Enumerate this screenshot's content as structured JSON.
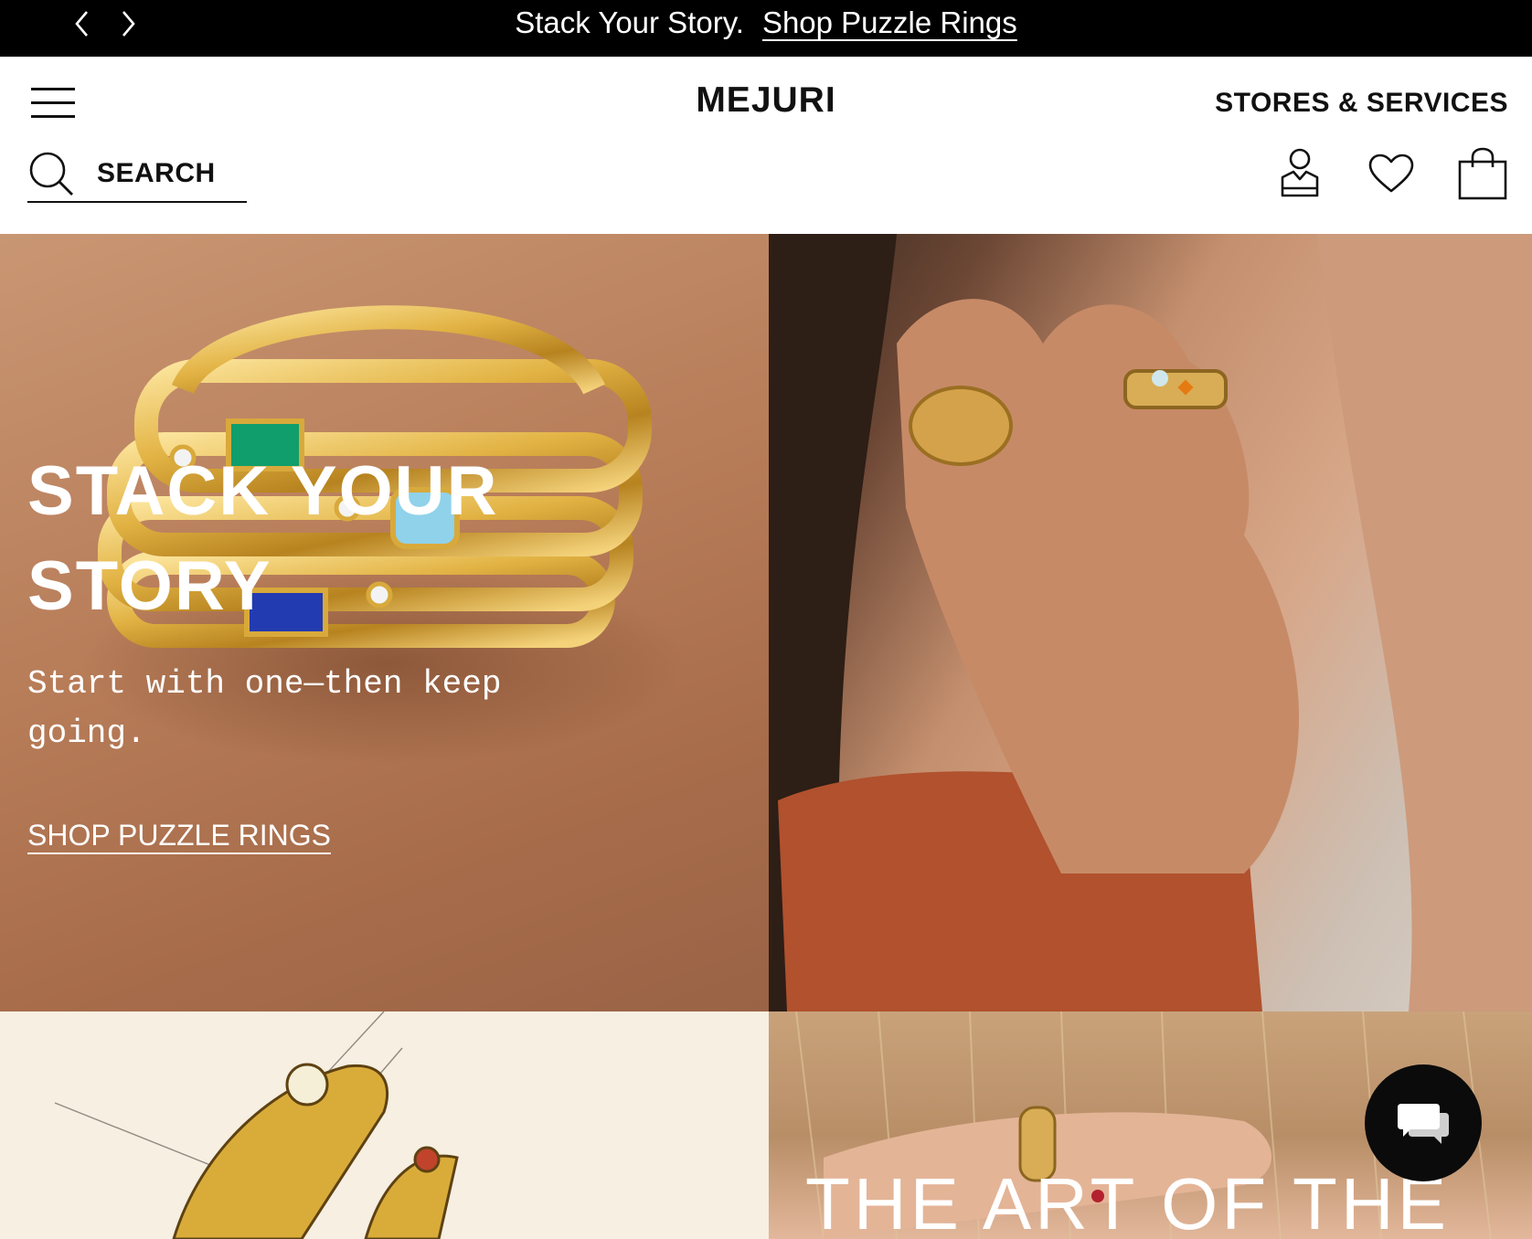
{
  "announcement": {
    "prev_label": "Previous announcement",
    "next_label": "Next announcement",
    "text": "Stack Your Story.",
    "link": "Shop Puzzle Rings"
  },
  "header": {
    "logo": "MEJURI",
    "stores_link": "STORES & SERVICES",
    "search_label": "SEARCH",
    "icons": [
      "menu-icon",
      "search-icon",
      "account-icon",
      "wishlist-heart-icon",
      "shopping-bag-icon"
    ]
  },
  "hero": {
    "title": "STACK YOUR STORY",
    "subtitle": "Start with one—then keep going.",
    "cta": "SHOP PUZZLE RINGS"
  },
  "secondary": {
    "art_title": "THE ART OF THE"
  },
  "chat": {
    "icon": "chat-bubble-icon"
  },
  "colors": {
    "announcement_bg": "#000000",
    "text_primary": "#111111",
    "hero_text": "#ffffff"
  }
}
